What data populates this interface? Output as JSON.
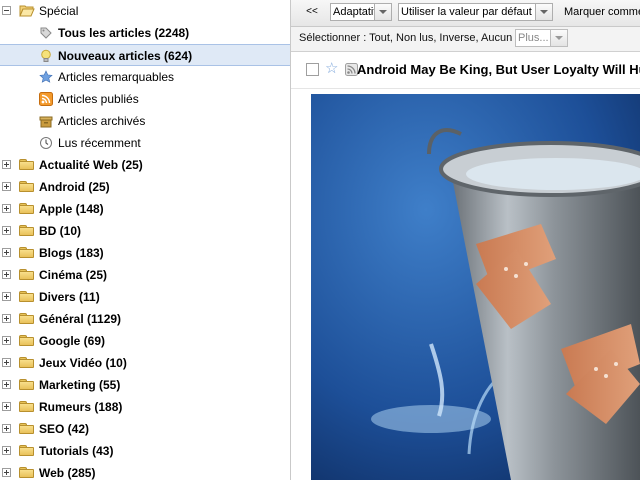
{
  "sidebar": {
    "special": {
      "label": "Spécial",
      "state": "expanded"
    },
    "special_items": [
      {
        "label": "Tous les articles (2248)",
        "icon": "tag-icon",
        "bold": true,
        "selected": false
      },
      {
        "label": "Nouveaux articles (624)",
        "icon": "bulb-icon",
        "bold": true,
        "selected": true
      },
      {
        "label": "Articles remarquables",
        "icon": "star-icon",
        "bold": false,
        "selected": false
      },
      {
        "label": "Articles publiés",
        "icon": "rss-icon",
        "bold": false,
        "selected": false
      },
      {
        "label": "Articles archivés",
        "icon": "archive-icon",
        "bold": false,
        "selected": false
      },
      {
        "label": "Lus récemment",
        "icon": "clock-icon",
        "bold": false,
        "selected": false
      }
    ],
    "categories": [
      {
        "label": "Actualité Web (25)"
      },
      {
        "label": "Android (25)"
      },
      {
        "label": "Apple (148)"
      },
      {
        "label": "BD (10)"
      },
      {
        "label": "Blogs (183)"
      },
      {
        "label": "Cinéma (25)"
      },
      {
        "label": "Divers (11)"
      },
      {
        "label": "Général (1129)"
      },
      {
        "label": "Google (69)"
      },
      {
        "label": "Jeux Vidéo (10)"
      },
      {
        "label": "Marketing (55)"
      },
      {
        "label": "Rumeurs (188)"
      },
      {
        "label": "SEO (42)"
      },
      {
        "label": "Tutorials (43)"
      },
      {
        "label": "Web (285)"
      }
    ]
  },
  "toolbar": {
    "collapse_label": "<<",
    "view_mode": "Adaptatif",
    "limit_mode": "Utiliser la valeur par défaut",
    "mark_label": "Marquer comme lu"
  },
  "selection_bar": {
    "label": "Sélectionner : Tout, Non lus, Inverse, Aucun",
    "more_label": "Plus..."
  },
  "article": {
    "title": "Android May Be King, But User Loyalty Will Hurt"
  },
  "colors": {
    "selected_bg": "#dfe9f6",
    "folder": "#e9c15a",
    "star": "#7fa7db"
  }
}
